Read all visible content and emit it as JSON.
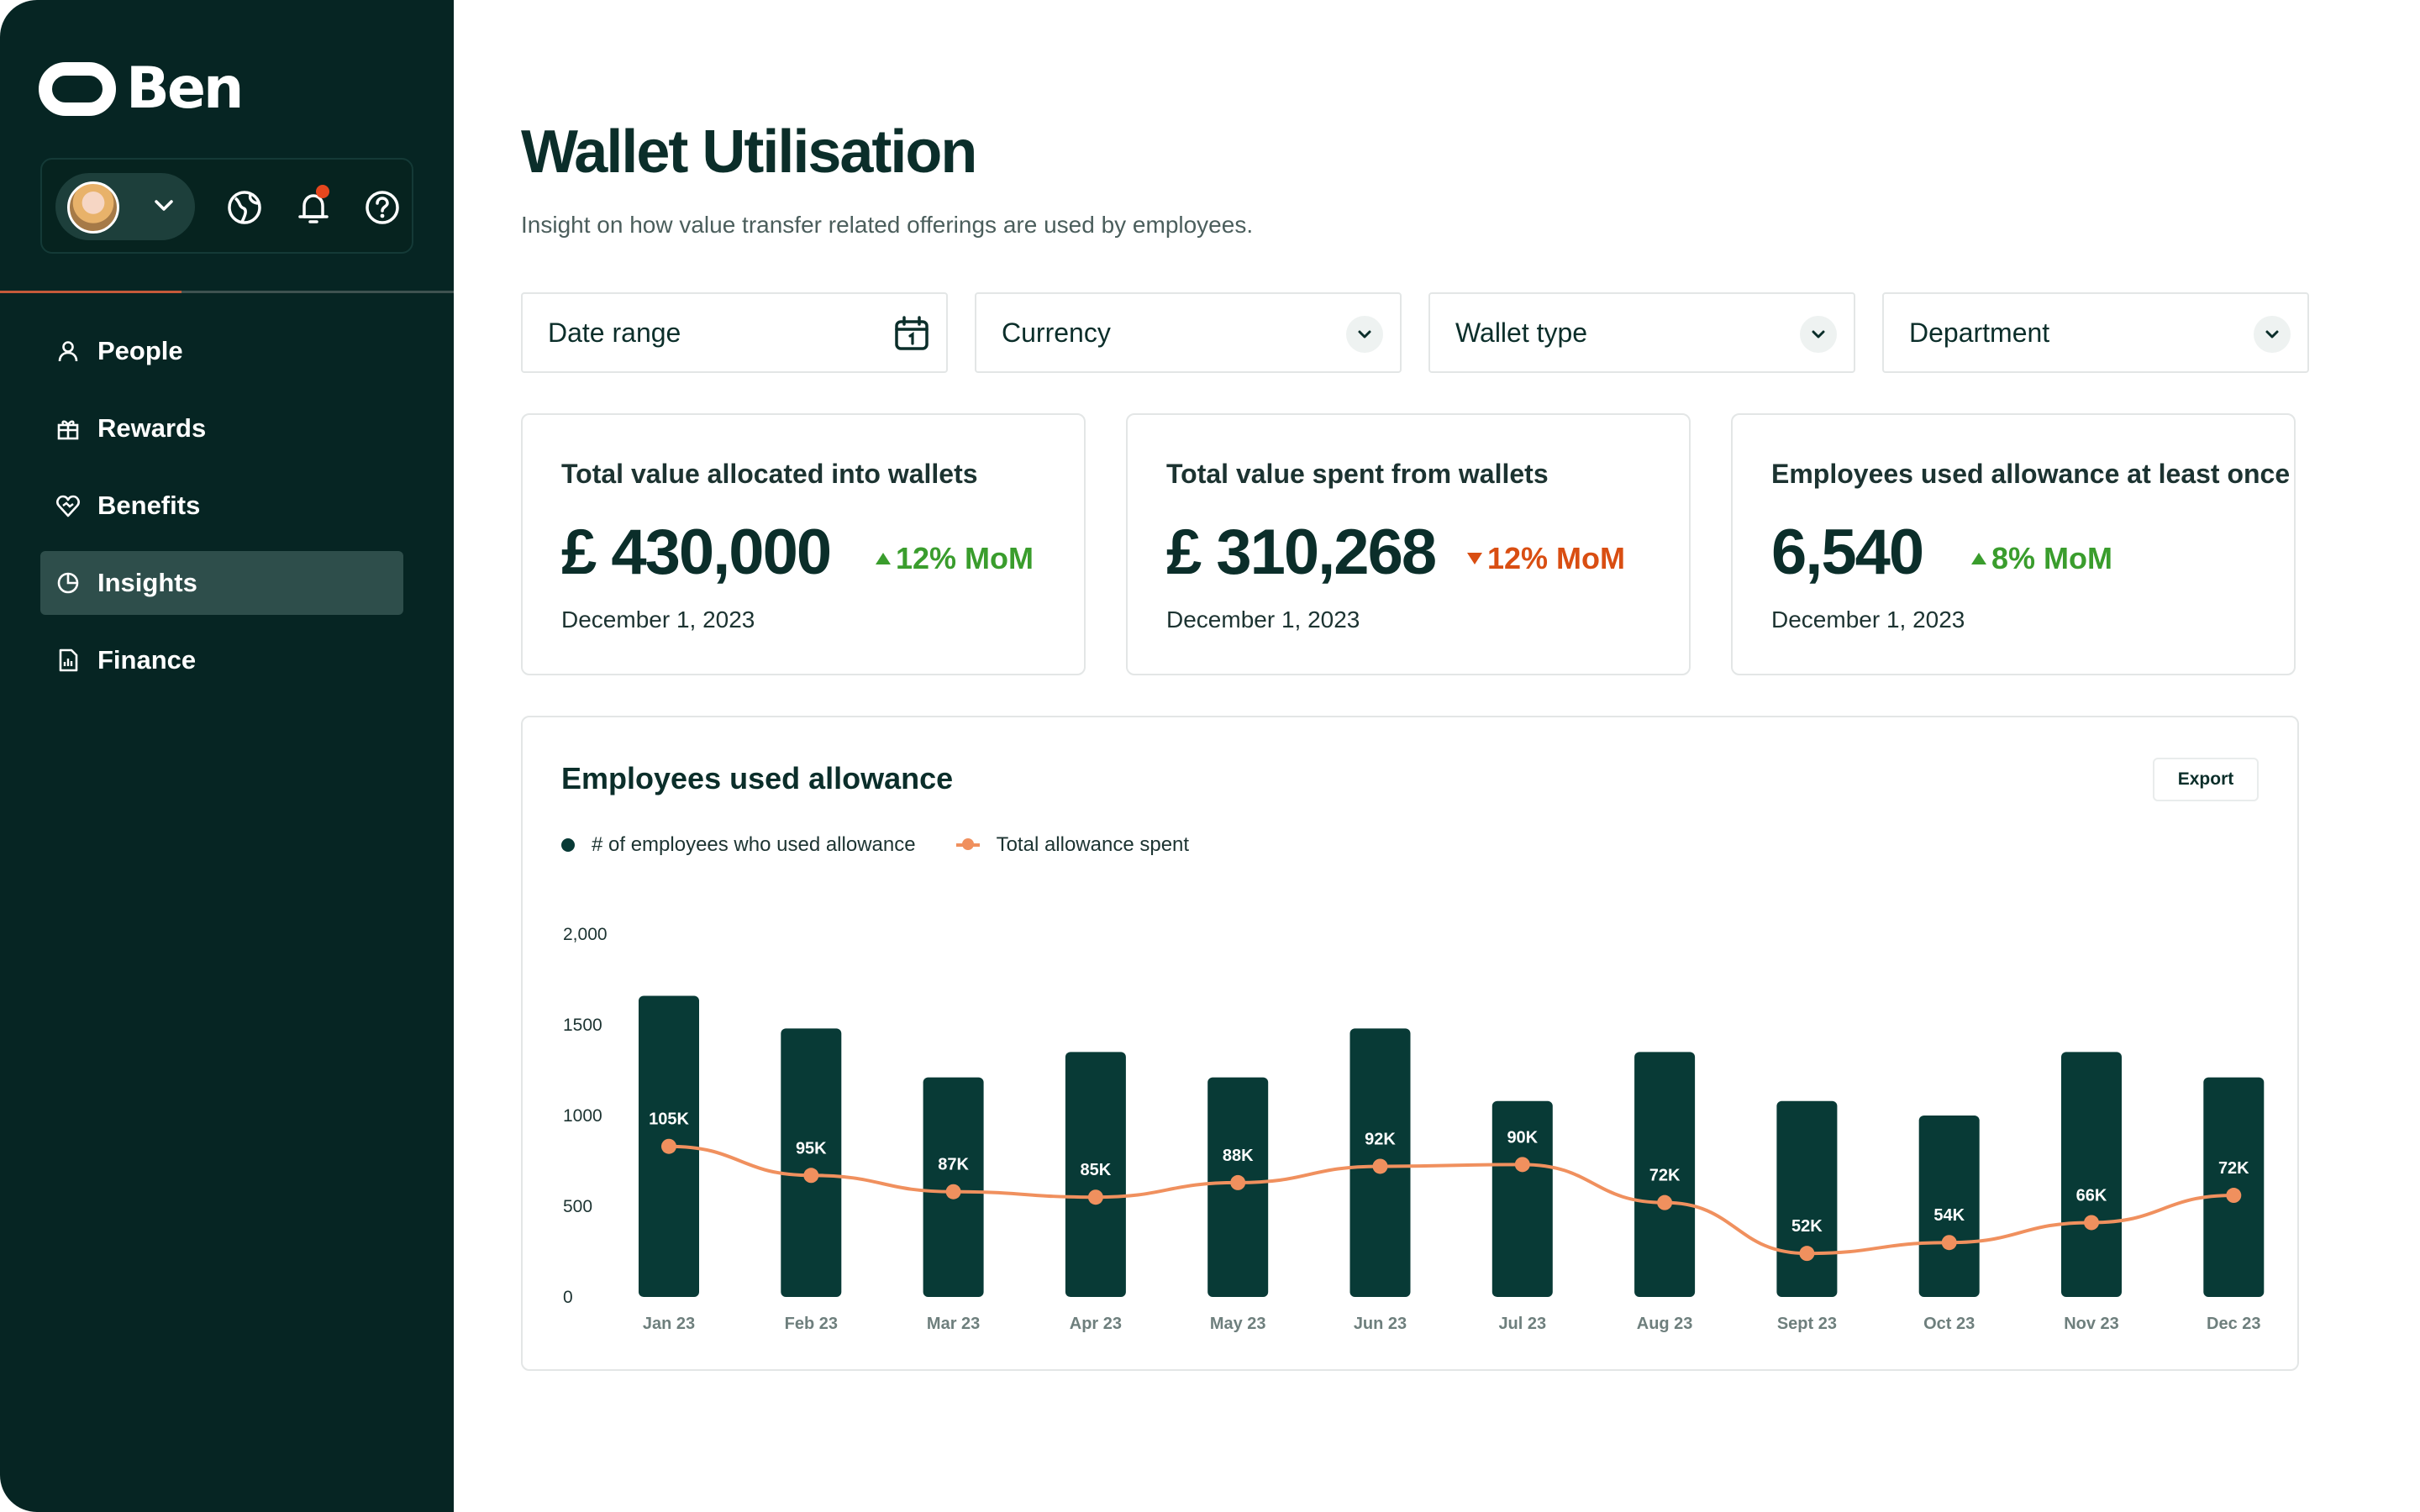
{
  "app": {
    "brand": "Ben"
  },
  "sidebar": {
    "items": [
      {
        "label": "People",
        "icon": "person-icon",
        "active": false
      },
      {
        "label": "Rewards",
        "icon": "gift-icon",
        "active": false
      },
      {
        "label": "Benefits",
        "icon": "heart-shield-icon",
        "active": false
      },
      {
        "label": "Insights",
        "icon": "pie-chart-icon",
        "active": true
      },
      {
        "label": "Finance",
        "icon": "finance-report-icon",
        "active": false
      }
    ]
  },
  "page": {
    "title": "Wallet Utilisation",
    "subtitle": "Insight on how value transfer related offerings are used by employees."
  },
  "filters": {
    "date_range": "Date range",
    "currency": "Currency",
    "wallet_type": "Wallet type",
    "department": "Department"
  },
  "kpis": [
    {
      "title": "Total value allocated into wallets",
      "value": "£ 430,000",
      "delta": "12% MoM",
      "direction": "up",
      "date": "December 1, 2023"
    },
    {
      "title": "Total value spent from wallets",
      "value": "£ 310,268",
      "delta": "12% MoM",
      "direction": "down",
      "date": "December 1, 2023"
    },
    {
      "title": "Employees used allowance at least once",
      "value": "6,540",
      "delta": "8% MoM",
      "direction": "up",
      "date": "December 1, 2023"
    }
  ],
  "chart_card": {
    "title": "Employees used allowance",
    "export_label": "Export",
    "legend": [
      "# of employees who used allowance",
      "Total allowance spent"
    ]
  },
  "colors": {
    "sidebar": "#062523",
    "bar": "#083a36",
    "line": "#f0905e",
    "up": "#3a9d2d",
    "down": "#d94e12",
    "active_nav": "#2e4e4b"
  },
  "chart_data": {
    "type": "bar",
    "categories": [
      "Jan 23",
      "Feb 23",
      "Mar 23",
      "Apr 23",
      "May 23",
      "Jun 23",
      "Jul 23",
      "Aug 23",
      "Sept 23",
      "Oct 23",
      "Nov 23",
      "Dec 23"
    ],
    "y_ticks": [
      "0",
      "500",
      "1000",
      "1500",
      "2,000"
    ],
    "ylim": [
      0,
      2000
    ],
    "grid": false,
    "legend_position": "top-left",
    "series": [
      {
        "name": "# of employees who used allowance",
        "type": "bar",
        "values": [
          1660,
          1480,
          1210,
          1350,
          1210,
          1480,
          1080,
          1350,
          1080,
          1000,
          1350,
          1210
        ]
      },
      {
        "name": "Total allowance spent",
        "type": "line",
        "values": [
          830,
          670,
          580,
          550,
          630,
          720,
          730,
          520,
          240,
          300,
          410,
          560
        ],
        "labels": [
          "105K",
          "95K",
          "87K",
          "85K",
          "88K",
          "92K",
          "90K",
          "72K",
          "52K",
          "54K",
          "66K",
          "72K"
        ]
      }
    ]
  }
}
